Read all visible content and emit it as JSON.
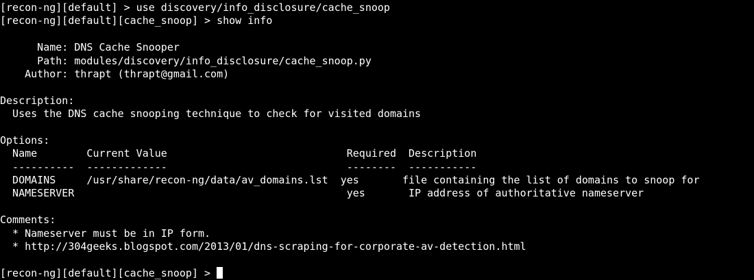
{
  "lines": [
    "[recon-ng][default] > use discovery/info_disclosure/cache_snoop",
    "[recon-ng][default][cache_snoop] > show info",
    "",
    "      Name: DNS Cache Snooper",
    "      Path: modules/discovery/info_disclosure/cache_snoop.py",
    "    Author: thrapt (thrapt@gmail.com)",
    "",
    "Description:",
    "  Uses the DNS cache snooping technique to check for visited domains",
    "",
    "Options:",
    "  Name        Current Value                             Required  Description",
    "  ----------  -------------                             --------  -----------",
    "  DOMAINS     /usr/share/recon-ng/data/av_domains.lst  yes       file containing the list of domains to snoop for",
    "  NAMESERVER                                            yes       IP address of authoritative nameserver",
    "",
    "Comments:",
    "  * Nameserver must be in IP form.",
    "  * http://304geeks.blogspot.com/2013/01/dns-scraping-for-corporate-av-detection.html",
    ""
  ],
  "prompt": "[recon-ng][default][cache_snoop] > ",
  "colors": {
    "background": "#000000",
    "foreground": "#ffffff"
  }
}
